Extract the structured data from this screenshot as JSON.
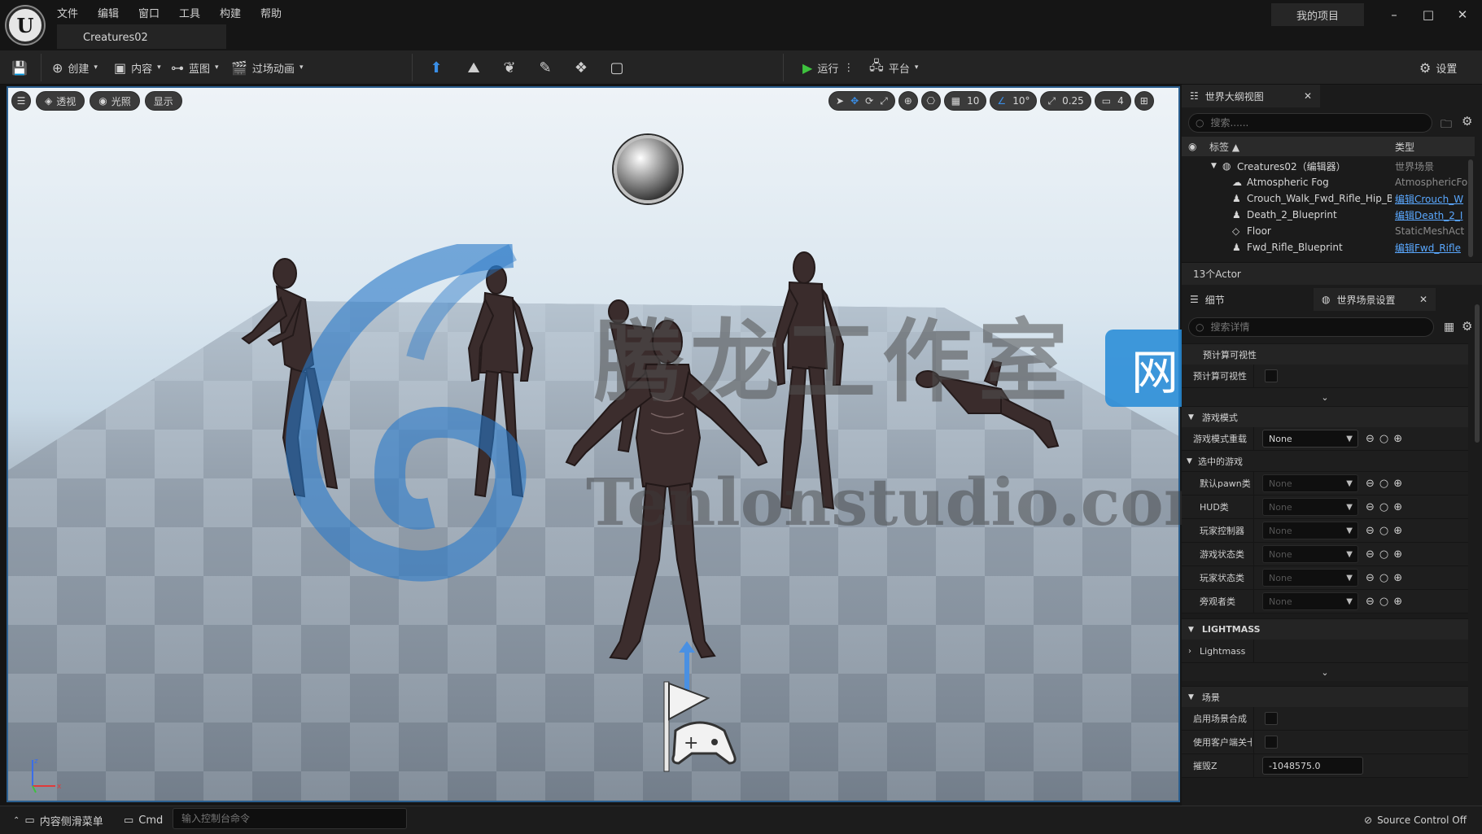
{
  "app": {
    "logo_text": "U",
    "menu": [
      "文件",
      "编辑",
      "窗口",
      "工具",
      "构建",
      "帮助"
    ],
    "document_tab": "Creatures02",
    "project_name": "我的项目",
    "window_controls": {
      "minimize": "–",
      "maximize": "□",
      "close": "✕"
    }
  },
  "toolbar": {
    "create": "创建",
    "content": "内容",
    "blueprint": "蓝图",
    "cinematics": "过场动画",
    "play": "运行",
    "platforms": "平台",
    "settings": "设置"
  },
  "viewport": {
    "perspective": "透视",
    "lit": "光照",
    "show": "显示",
    "grid_snap": "10",
    "rotation_snap": "10°",
    "scale_snap": "0.25",
    "camera_speed": "4"
  },
  "outliner": {
    "tab_label": "世界大纲视图",
    "search_placeholder": "搜索......",
    "col_label": "标签 ▲",
    "col_type": "类型",
    "rows": [
      {
        "label": "Creatures02（编辑器）",
        "type": "世界场景",
        "link": false
      },
      {
        "label": "Atmospheric Fog",
        "type": "AtmosphericFo",
        "link": false
      },
      {
        "label": "Crouch_Walk_Fwd_Rifle_Hip_B",
        "type": "编辑Crouch_W",
        "link": true
      },
      {
        "label": "Death_2_Blueprint",
        "type": "编辑Death_2_I",
        "link": true
      },
      {
        "label": "Floor",
        "type": "StaticMeshAct",
        "link": false
      },
      {
        "label": "Fwd_Rifle_Blueprint",
        "type": "编辑Fwd_Rifle",
        "link": true
      }
    ],
    "actor_count": "13个Actor"
  },
  "details": {
    "tab_label": "细节",
    "world_settings_tab": "世界场景设置",
    "search_placeholder": "搜索详情",
    "precompute_header": "预计算可视性",
    "precompute_row": "预计算可视性",
    "game_mode_header": "游戏模式",
    "game_mode_override": "游戏模式重载",
    "game_mode_value": "None",
    "selected_game_mode": "选中的游戏",
    "game_rows": [
      {
        "label": "默认pawn类",
        "value": "None"
      },
      {
        "label": "HUD类",
        "value": "None"
      },
      {
        "label": "玩家控制器",
        "value": "None"
      },
      {
        "label": "游戏状态类",
        "value": "None"
      },
      {
        "label": "玩家状态类",
        "value": "None"
      },
      {
        "label": "旁观者类",
        "value": "None"
      }
    ],
    "lightmass_header": "LIGHTMASS",
    "lightmass_row": "Lightmass",
    "scene_header": "场景",
    "scene_rows": [
      {
        "label": "启用场景合成"
      },
      {
        "label": "使用客户端关卡"
      }
    ],
    "kill_z_label": "摧毁Z",
    "kill_z_value": "-1048575.0"
  },
  "statusbar": {
    "content_drawer": "内容侧滑菜单",
    "cmd": "Cmd",
    "cmd_placeholder": "输入控制台命令",
    "source_control": "Source Control Off"
  },
  "watermark": {
    "text_cn": "腾龙工作室",
    "text_en": "Tenlonstudio.com",
    "badge": "网站"
  },
  "colors": {
    "accent_blue": "#2b5f8f",
    "play_green": "#3ec23e",
    "link_blue": "#5aa8ff",
    "watermark_blue": "#288cd7"
  }
}
